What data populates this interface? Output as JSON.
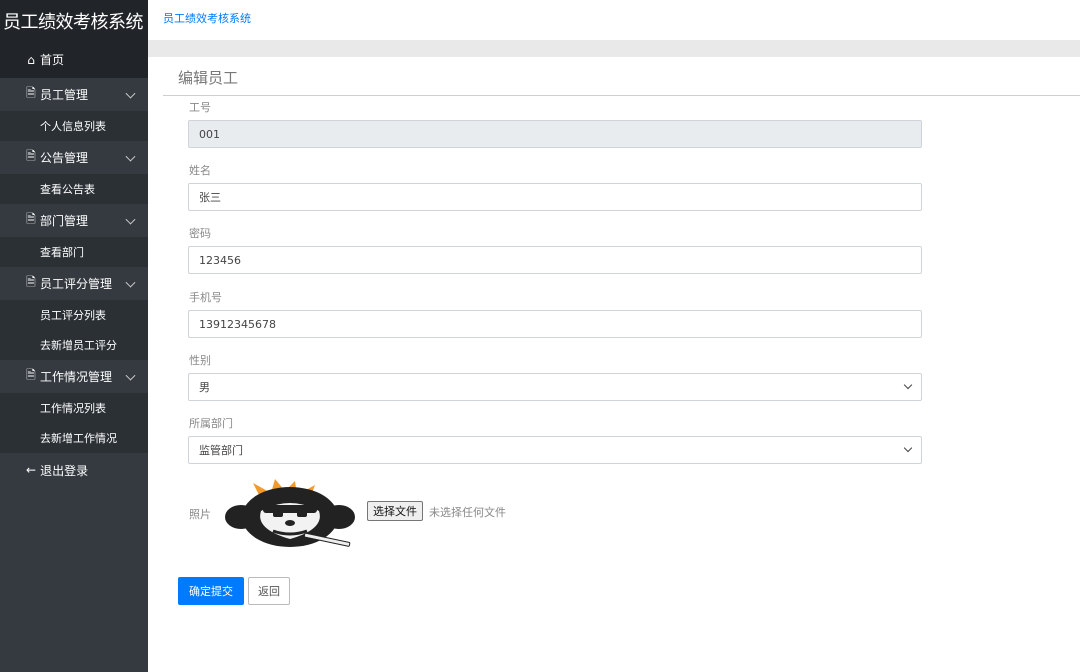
{
  "app": {
    "brand": "员工绩效考核系统"
  },
  "header": {
    "breadcrumb": "员工绩效考核系统"
  },
  "sidebar": {
    "home": {
      "icon": "home-icon",
      "label": "首页"
    },
    "groups": [
      {
        "icon": "document-icon",
        "label": "员工管理",
        "items": [
          "个人信息列表"
        ]
      },
      {
        "icon": "document-icon",
        "label": "公告管理",
        "items": [
          "查看公告表"
        ]
      },
      {
        "icon": "document-icon",
        "label": "部门管理",
        "items": [
          "查看部门"
        ]
      },
      {
        "icon": "document-icon",
        "label": "员工评分管理",
        "items": [
          "员工评分列表",
          "去新增员工评分"
        ]
      },
      {
        "icon": "document-icon",
        "label": "工作情况管理",
        "items": [
          "工作情况列表",
          "去新增工作情况"
        ]
      }
    ],
    "logout": {
      "icon": "arrow-left-icon",
      "label": "退出登录"
    }
  },
  "form": {
    "title": "编辑员工",
    "fields": {
      "employee_id": {
        "label": "工号",
        "value": "001"
      },
      "name": {
        "label": "姓名",
        "value": "张三"
      },
      "password": {
        "label": "密码",
        "value": "123456"
      },
      "phone": {
        "label": "手机号",
        "value": "13912345678"
      },
      "gender": {
        "label": "性别",
        "value": "男"
      },
      "department": {
        "label": "所属部门",
        "value": "监管部门"
      },
      "photo": {
        "label": "照片",
        "choose_button": "选择文件",
        "no_file": "未选择任何文件"
      }
    },
    "submit_label": "确定提交",
    "back_label": "返回"
  },
  "colors": {
    "sidebar": "#343a40",
    "brand_bg": "#212529",
    "primary": "#007bff"
  }
}
